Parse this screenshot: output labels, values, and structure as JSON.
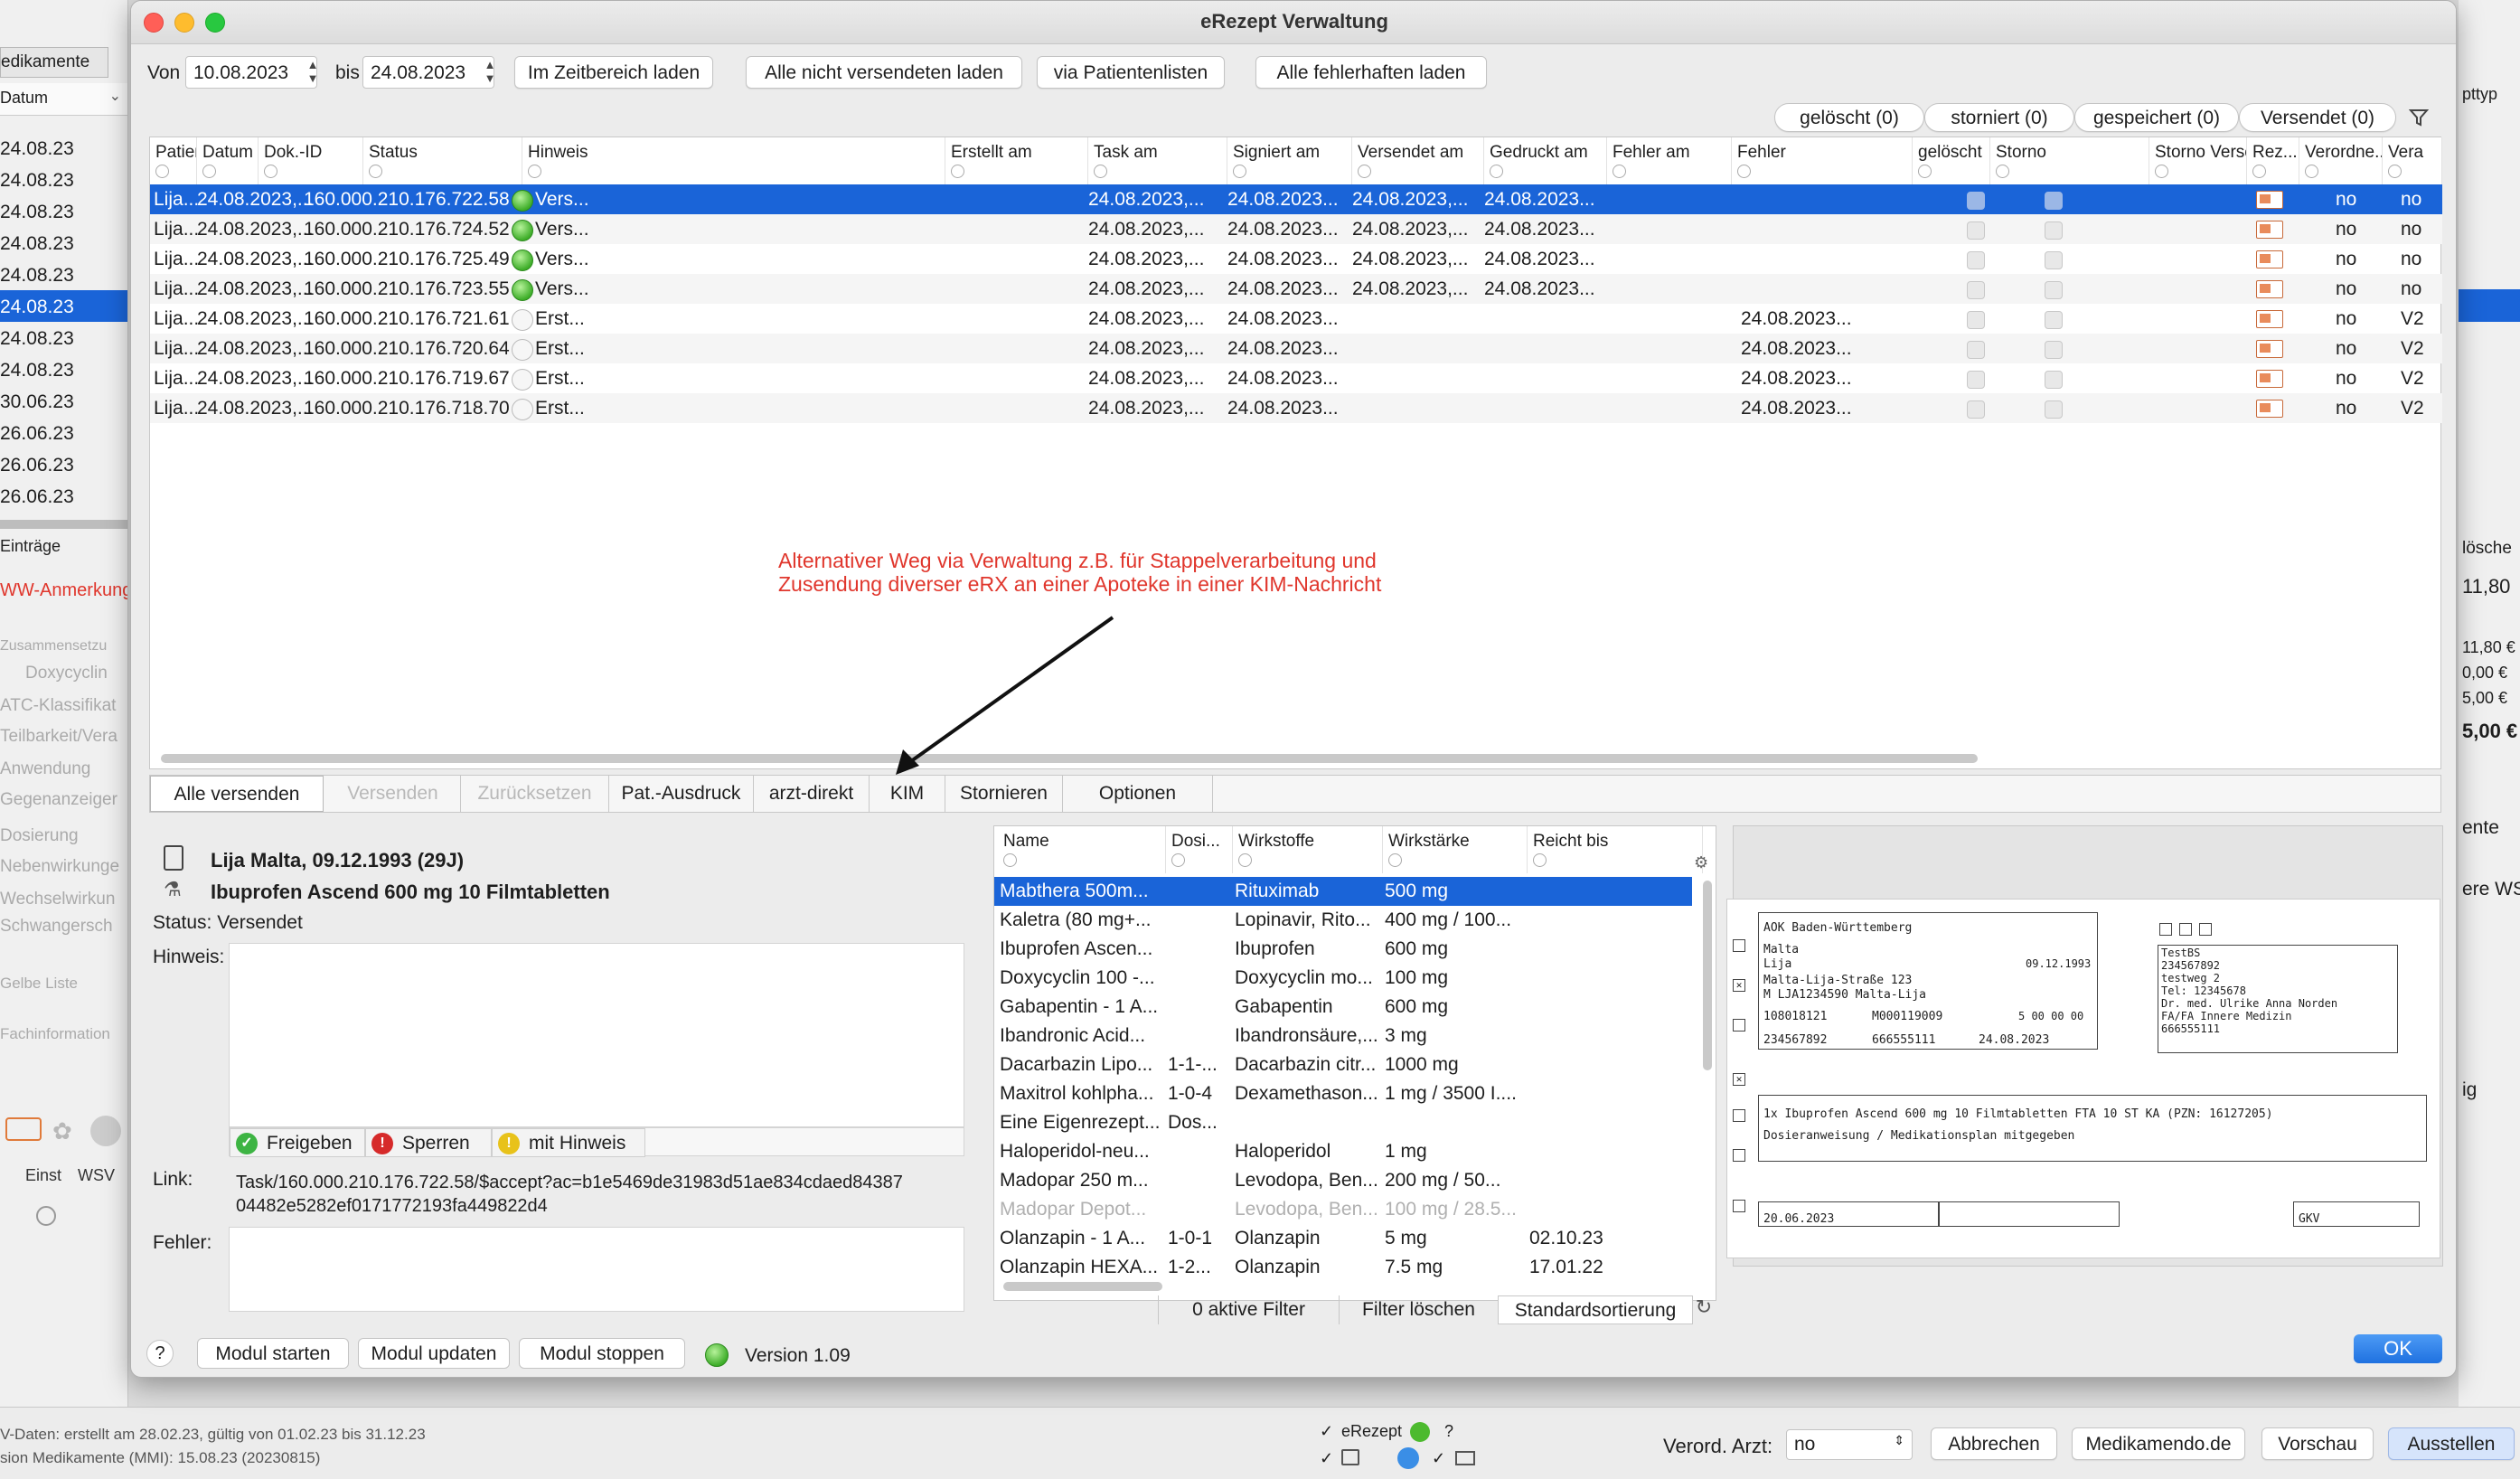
{
  "dialog": {
    "title": "eRezept Verwaltung",
    "from_label": "Von",
    "from_date": "10.08.2023",
    "to_label": "bis",
    "to_date": "24.08.2023",
    "toolbar": [
      "Im Zeitbereich laden",
      "Alle nicht versendeten laden",
      "via Patientenlisten",
      "Alle fehlerhaften laden"
    ],
    "filters": [
      "gelöscht (0)",
      "storniert (0)",
      "gespeichert (0)",
      "Versendet (0)"
    ]
  },
  "table": {
    "columns": [
      "Patient",
      "Datum der...",
      "Dok.-ID",
      "Status",
      "Hinweis",
      "Erstellt am",
      "Task am",
      "Signiert am",
      "Versendet am",
      "Gedruckt am",
      "Fehler am",
      "Fehler",
      "gelöscht",
      "Storno",
      "Storno Verse...",
      "Rez...",
      "Verordne...",
      "Vera"
    ],
    "rows": [
      {
        "patient": "Lija...",
        "datum": "24.08.2023,...",
        "dokid": "160.000.210.176.722.58",
        "status": "Vers...",
        "erstellt": "24.08.2023,...",
        "task": "24.08.2023...",
        "signiert": "24.08.2023,...",
        "versendet": "24.08.2023...",
        "fehler_am": "",
        "verordnet": "no",
        "vera": "no"
      },
      {
        "patient": "Lija...",
        "datum": "24.08.2023,...",
        "dokid": "160.000.210.176.724.52",
        "status": "Vers...",
        "erstellt": "24.08.2023,...",
        "task": "24.08.2023...",
        "signiert": "24.08.2023,...",
        "versendet": "24.08.2023...",
        "fehler_am": "",
        "verordnet": "no",
        "vera": "no"
      },
      {
        "patient": "Lija...",
        "datum": "24.08.2023,...",
        "dokid": "160.000.210.176.725.49",
        "status": "Vers...",
        "erstellt": "24.08.2023,...",
        "task": "24.08.2023...",
        "signiert": "24.08.2023,...",
        "versendet": "24.08.2023...",
        "fehler_am": "",
        "verordnet": "no",
        "vera": "no"
      },
      {
        "patient": "Lija...",
        "datum": "24.08.2023,...",
        "dokid": "160.000.210.176.723.55",
        "status": "Vers...",
        "erstellt": "24.08.2023,...",
        "task": "24.08.2023...",
        "signiert": "24.08.2023,...",
        "versendet": "24.08.2023...",
        "fehler_am": "",
        "verordnet": "no",
        "vera": "no"
      },
      {
        "patient": "Lija...",
        "datum": "24.08.2023,...",
        "dokid": "160.000.210.176.721.61",
        "status": "Erst...",
        "erstellt": "24.08.2023,...",
        "task": "24.08.2023...",
        "signiert": "",
        "versendet": "",
        "fehler_am": "24.08.2023...",
        "verordnet": "no",
        "vera": "V2"
      },
      {
        "patient": "Lija...",
        "datum": "24.08.2023,...",
        "dokid": "160.000.210.176.720.64",
        "status": "Erst...",
        "erstellt": "24.08.2023,...",
        "task": "24.08.2023...",
        "signiert": "",
        "versendet": "",
        "fehler_am": "24.08.2023...",
        "verordnet": "no",
        "vera": "V2"
      },
      {
        "patient": "Lija...",
        "datum": "24.08.2023,...",
        "dokid": "160.000.210.176.719.67",
        "status": "Erst...",
        "erstellt": "24.08.2023,...",
        "task": "24.08.2023...",
        "signiert": "",
        "versendet": "",
        "fehler_am": "24.08.2023...",
        "verordnet": "no",
        "vera": "V2"
      },
      {
        "patient": "Lija...",
        "datum": "24.08.2023,...",
        "dokid": "160.000.210.176.718.70",
        "status": "Erst...",
        "erstellt": "24.08.2023,...",
        "task": "24.08.2023...",
        "signiert": "",
        "versendet": "",
        "fehler_am": "24.08.2023...",
        "verordnet": "no",
        "vera": "V2"
      }
    ]
  },
  "annotation": {
    "line1": "Alternativer Weg via Verwaltung z.B. für Stappelverarbeitung und",
    "line2": "Zusendung diverser eRX an einer Apoteke in einer KIM-Nachricht",
    "color": "#e0362c"
  },
  "actions": [
    "Alle versenden",
    "Versenden",
    "Zurücksetzen",
    "Pat.-Ausdruck",
    "arzt-direkt",
    "KIM",
    "Stornieren",
    "Optionen"
  ],
  "detail": {
    "patient": "Lija Malta, 09.12.1993 (29J)",
    "drug": "Ibuprofen Ascend 600 mg 10 Filmtabletten",
    "status": "Status:  Versendet",
    "hinweis_label": "Hinweis:",
    "freigeben": "Freigeben",
    "sperren": "Sperren",
    "mit_hinweis": "mit Hinweis",
    "link_label": "Link:",
    "link_line1": "Task/160.000.210.176.722.58/$accept?ac=b1e5469de31983d51ae834cdaed84387",
    "link_line2": "04482e5282ef0171772193fa449822d4",
    "fehler_label": "Fehler:"
  },
  "meds": {
    "columns": [
      "Name",
      "Dosi...",
      "Wirkstoffe",
      "Wirkstärke",
      "Reicht bis"
    ],
    "rows": [
      {
        "name": "Mabthera 500m...",
        "dosis": "",
        "wirkstoff": "Rituximab",
        "staerke": "500 mg",
        "reicht": ""
      },
      {
        "name": "Kaletra (80 mg+...",
        "dosis": "",
        "wirkstoff": "Lopinavir, Rito...",
        "staerke": "400 mg / 100...",
        "reicht": ""
      },
      {
        "name": "Ibuprofen Ascen...",
        "dosis": "",
        "wirkstoff": "Ibuprofen",
        "staerke": "600 mg",
        "reicht": ""
      },
      {
        "name": "Doxycyclin 100 -...",
        "dosis": "",
        "wirkstoff": "Doxycyclin mo...",
        "staerke": "100 mg",
        "reicht": ""
      },
      {
        "name": "Gabapentin - 1 A...",
        "dosis": "",
        "wirkstoff": "Gabapentin",
        "staerke": "600 mg",
        "reicht": ""
      },
      {
        "name": "Ibandronic Acid...",
        "dosis": "",
        "wirkstoff": "Ibandronsäure,...",
        "staerke": "3 mg",
        "reicht": ""
      },
      {
        "name": "Dacarbazin Lipo...",
        "dosis": "1-1-...",
        "wirkstoff": "Dacarbazin citr...",
        "staerke": "1000 mg",
        "reicht": ""
      },
      {
        "name": "Maxitrol kohlpha...",
        "dosis": "1-0-4",
        "wirkstoff": "Dexamethason...",
        "staerke": "1 mg / 3500 I....",
        "reicht": ""
      },
      {
        "name": "Eine Eigenrezept...",
        "dosis": "Dos...",
        "wirkstoff": "",
        "staerke": "",
        "reicht": ""
      },
      {
        "name": "Haloperidol-neu...",
        "dosis": "",
        "wirkstoff": "Haloperidol",
        "staerke": "1 mg",
        "reicht": ""
      },
      {
        "name": "Madopar 250 m...",
        "dosis": "",
        "wirkstoff": "Levodopa, Ben...",
        "staerke": "200 mg / 50...",
        "reicht": ""
      },
      {
        "name": "Madopar Depot...",
        "dosis": "",
        "wirkstoff": "Levodopa, Ben...",
        "staerke": "100 mg / 28.5...",
        "reicht": ""
      },
      {
        "name": "Olanzapin - 1 A...",
        "dosis": "1-0-1",
        "wirkstoff": "Olanzapin",
        "staerke": "5 mg",
        "reicht": "02.10.23"
      },
      {
        "name": "Olanzapin HEXA...",
        "dosis": "1-2...",
        "wirkstoff": "Olanzapin",
        "staerke": "7.5 mg",
        "reicht": "17.01.22"
      }
    ],
    "aktive_filter": "0 aktive Filter",
    "filter_loeschen": "Filter löschen",
    "standard": "Standardsortierung"
  },
  "rx": {
    "kasse": "AOK Baden-Württemberg",
    "name1": "Malta",
    "name2": "Lija",
    "dob": "09.12.1993",
    "street": "Malta-Lija-Straße 123",
    "city": "M LJA1234590 Malta-Lija",
    "kassennr": "108018121",
    "versnr": "M000119009",
    "statusnr": "5 00 00 00",
    "bsnr": "234567892",
    "lanr": "666555111",
    "datum": "24.08.2023",
    "drug": "1x Ibuprofen Ascend 600 mg 10 Filmtabletten FTA 10 ST KA (PZN: 16127205)",
    "dosage": "Dosieranweisung / Medikationsplan mitgegeben",
    "unfalltag": "20.06.2023",
    "gkv": "GKV",
    "arzt": [
      "TestBS",
      "234567892",
      "testweg  2",
      "Tel: 12345678",
      "Dr. med. Ulrike Anna Norden",
      "FA/FA Innere Medizin",
      "666555111"
    ]
  },
  "footer": {
    "help": "?",
    "buttons": [
      "Modul starten",
      "Modul updaten",
      "Modul stoppen"
    ],
    "version": "Version 1.09",
    "ok": "OK"
  },
  "background": {
    "tab": "edikamente",
    "col": "Datum",
    "dates": [
      "24.08.23",
      "24.08.23",
      "24.08.23",
      "24.08.23",
      "24.08.23",
      "24.08.23",
      "24.08.23",
      "24.08.23",
      "30.06.23",
      "26.06.23",
      "26.06.23",
      "26.06.23"
    ],
    "eintraege": "Einträge",
    "ww": "WW-Anmerkung",
    "labels": [
      "Zusammensetzu",
      "Doxycyclin",
      "ATC-Klassifikat",
      "Teilbarkeit/Vera",
      "Anwendung",
      "Gegenanzeiger",
      "Dosierung",
      "Nebenwirkunge",
      "Wechselwirkun",
      "Schwangersch",
      "Gelbe Liste",
      "Fachinformation"
    ],
    "einst": "Einst",
    "wsv": "WSV",
    "right": [
      "pttyp",
      "lösche",
      "11,80",
      "11,80 €",
      "0,00 €",
      "5,00 €",
      "5,00 €",
      "ente",
      "ere WS",
      "ig"
    ],
    "status1": "V-Daten: erstellt am 28.02.23, gültig von 01.02.23 bis 31.12.23",
    "status2": "sion Medikamente (MMI): 15.08.23 (20230815)",
    "erezept": "eRezept",
    "verord_label": "Verord. Arzt:",
    "verord_value": "no",
    "btns": [
      "Abbrechen",
      "Medikamendo.de",
      "Vorschau",
      "Ausstellen"
    ]
  }
}
